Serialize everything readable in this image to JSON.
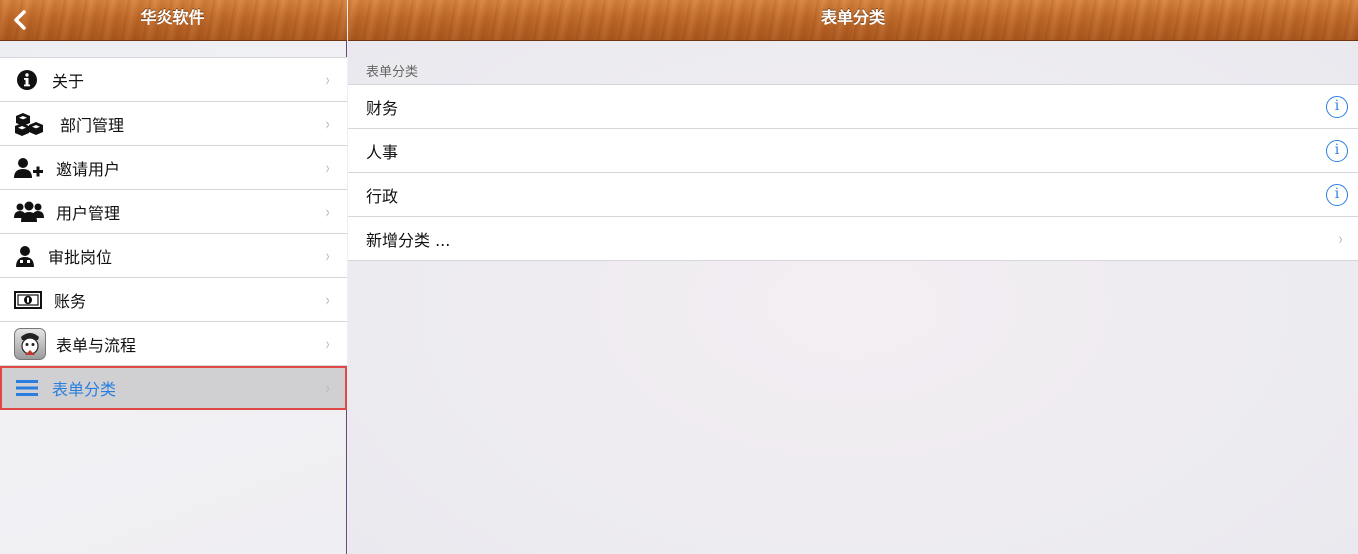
{
  "left_pane": {
    "nav_title": "华炎软件",
    "back_glyph": "‹",
    "menu": [
      {
        "label": "关于",
        "icon": "info-icon"
      },
      {
        "label": "部门管理",
        "icon": "boxes-icon"
      },
      {
        "label": "邀请用户",
        "icon": "user-plus-icon"
      },
      {
        "label": "用户管理",
        "icon": "users-icon"
      },
      {
        "label": "审批岗位",
        "icon": "approver-icon"
      },
      {
        "label": "账务",
        "icon": "money-icon"
      },
      {
        "label": "表单与流程",
        "icon": "app-avatar-icon"
      },
      {
        "label": "表单分类",
        "icon": "list-icon",
        "selected": true
      }
    ],
    "chevron": "›"
  },
  "right_pane": {
    "nav_title": "表单分类",
    "section_header": "表单分类",
    "items": [
      {
        "label": "财务",
        "accessory": "i"
      },
      {
        "label": "人事",
        "accessory": "i"
      },
      {
        "label": "行政",
        "accessory": "i"
      },
      {
        "label": "新增分类 ...",
        "accessory": "›"
      }
    ]
  },
  "colors": {
    "accent": "#2a7ee0",
    "selection_outline": "#e04848",
    "wood_top": "#d9853f",
    "wood_bottom": "#a9561d"
  }
}
